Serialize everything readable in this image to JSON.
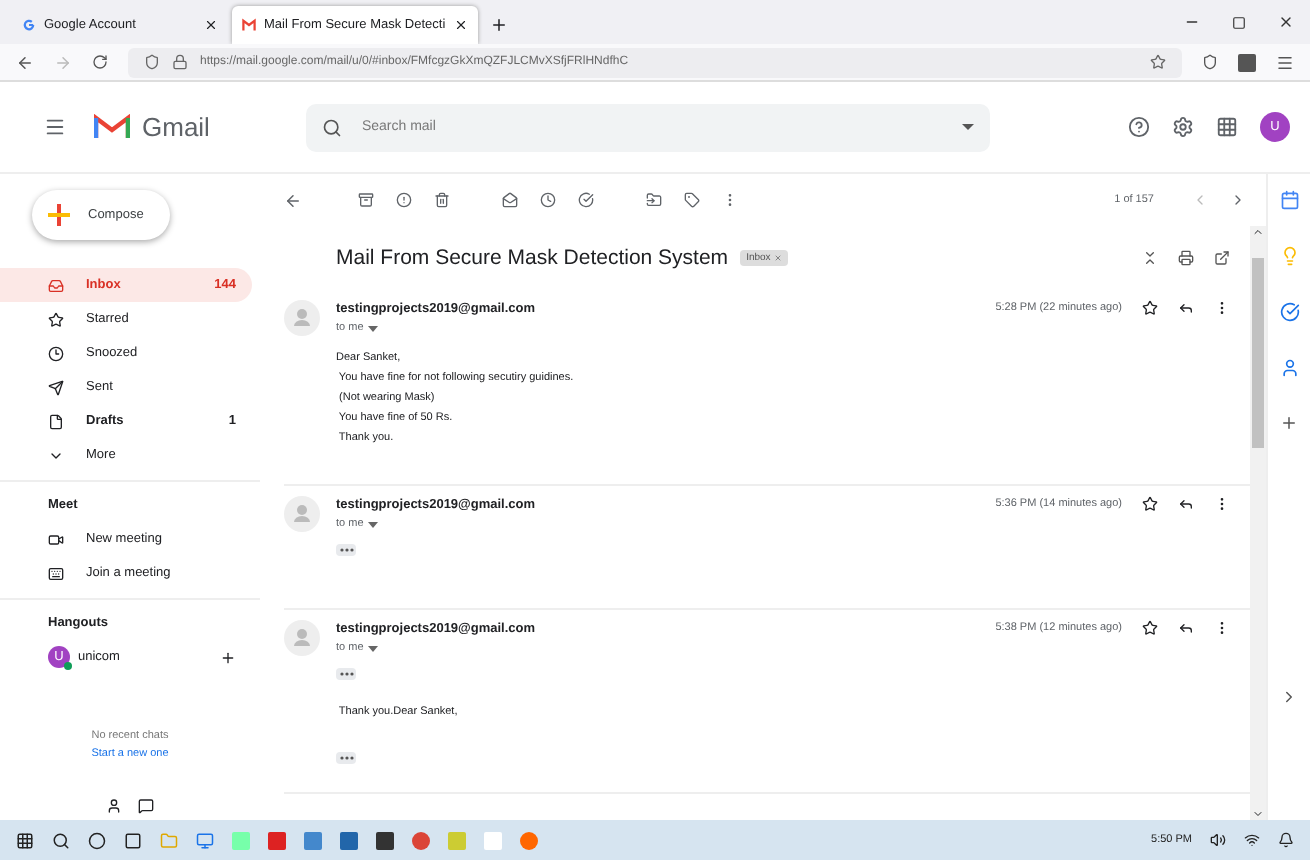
{
  "browser": {
    "tabs": [
      {
        "title": "Google Account",
        "selected": false
      },
      {
        "title": "Mail From Secure Mask Detecti",
        "selected": true
      }
    ],
    "url": "https://mail.google.com/mail/u/0/#inbox/FMfcgzGkXmQZFJLCMvXSfjFRlHNdfhC"
  },
  "header": {
    "app_name": "Gmail",
    "search_placeholder": "Search mail",
    "avatar": "U"
  },
  "sidebar": {
    "compose": "Compose",
    "items": [
      {
        "label": "Inbox",
        "count": "144",
        "selected": true,
        "bold": true
      },
      {
        "label": "Starred",
        "selected": false,
        "bold": false
      },
      {
        "label": "Snoozed",
        "selected": false,
        "bold": false
      },
      {
        "label": "Sent",
        "selected": false,
        "bold": false
      },
      {
        "label": "Drafts",
        "count": "1",
        "selected": false,
        "bold": true
      },
      {
        "label": "More",
        "selected": false,
        "bold": false
      }
    ],
    "meet": {
      "title": "Meet",
      "items": [
        "New meeting",
        "Join a meeting"
      ]
    },
    "hangouts": {
      "title": "Hangouts",
      "user": {
        "initial": "U",
        "name": "unicom",
        "online": true
      },
      "empty": "No recent chats",
      "link": "Start a new one"
    }
  },
  "toolbar": {
    "pager": "1 of 157"
  },
  "thread": {
    "subject": "Mail From Secure Mask Detection System",
    "label": "Inbox",
    "messages": [
      {
        "sender": "testingprojects2019@gmail.com",
        "to": "to me",
        "time": "5:28 PM (22 minutes ago)",
        "parts": [
          {
            "kind": "text",
            "lines": [
              "Dear Sanket,",
              " You have fine for not following secutiry guidines.",
              " (Not wearing Mask)",
              " You have fine of 50 Rs.",
              " Thank you."
            ]
          }
        ]
      },
      {
        "sender": "testingprojects2019@gmail.com",
        "to": "to me",
        "time": "5:36 PM (14 minutes ago)",
        "parts": [
          {
            "kind": "more"
          }
        ]
      },
      {
        "sender": "testingprojects2019@gmail.com",
        "to": "to me",
        "time": "5:38 PM (12 minutes ago)",
        "parts": [
          {
            "kind": "more"
          },
          {
            "kind": "text",
            "lines": [
              " Thank you.Dear Sanket,"
            ]
          },
          {
            "kind": "more"
          }
        ]
      }
    ]
  },
  "taskbar": {
    "time": "5:50 PM"
  }
}
